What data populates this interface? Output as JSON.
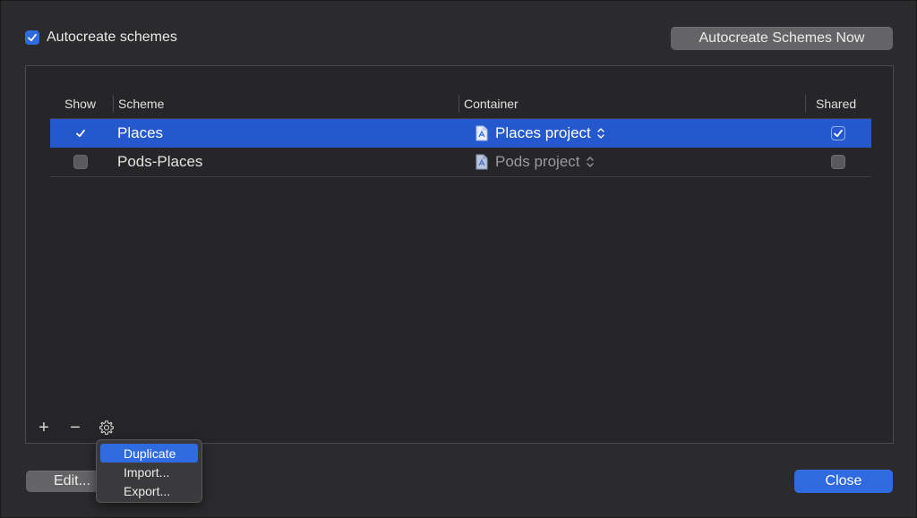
{
  "header": {
    "autocreate_label": "Autocreate schemes",
    "autocreate_checked": true,
    "autocreate_now_label": "Autocreate Schemes Now"
  },
  "table": {
    "columns": [
      "Show",
      "Scheme",
      "Container",
      "Shared"
    ],
    "rows": [
      {
        "show": true,
        "scheme": "Places",
        "container": "Places project",
        "shared": true,
        "selected": true
      },
      {
        "show": false,
        "scheme": "Pods-Places",
        "container": "Pods project",
        "shared": false,
        "selected": false
      }
    ]
  },
  "toolbar": {
    "add_label": "+",
    "remove_label": "−",
    "gear_icon": "gear-icon"
  },
  "menu": {
    "items": [
      {
        "label": "Duplicate",
        "active": true
      },
      {
        "label": "Import...",
        "active": false
      },
      {
        "label": "Export...",
        "active": false
      }
    ]
  },
  "footer": {
    "edit_label": "Edit...",
    "close_label": "Close"
  },
  "colors": {
    "accent": "#2f6ae0",
    "selection": "#2458cc",
    "background": "#2b2b2d"
  }
}
